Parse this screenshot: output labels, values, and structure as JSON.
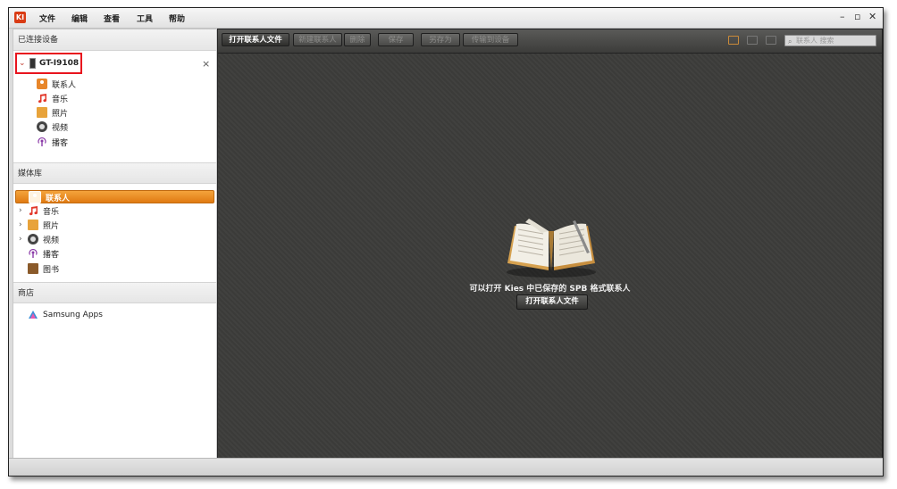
{
  "app": {
    "logo_text": "KI"
  },
  "menu": {
    "file": "文件",
    "edit": "编辑",
    "view": "查看",
    "tools": "工具",
    "help": "帮助"
  },
  "window_controls": {
    "minimize": "–",
    "restore": "▫",
    "close": "✕"
  },
  "sidebar": {
    "connected_header": "已连接设备",
    "device": {
      "name": "GT-I9108",
      "close": "×"
    },
    "device_items": [
      {
        "label": "联系人",
        "icon": "contacts-icon"
      },
      {
        "label": "音乐",
        "icon": "music-icon"
      },
      {
        "label": "照片",
        "icon": "photo-icon"
      },
      {
        "label": "视频",
        "icon": "video-icon"
      },
      {
        "label": "播客",
        "icon": "podcast-icon"
      }
    ],
    "library_header": "媒体库",
    "library_items": [
      {
        "label": "联系人",
        "icon": "contacts-icon",
        "selected": true
      },
      {
        "label": "音乐",
        "icon": "music-icon"
      },
      {
        "label": "照片",
        "icon": "photo-icon"
      },
      {
        "label": "视频",
        "icon": "video-icon"
      },
      {
        "label": "播客",
        "icon": "podcast-icon"
      },
      {
        "label": "图书",
        "icon": "book-icon"
      }
    ],
    "store_header": "商店",
    "store_items": [
      {
        "label": "Samsung Apps",
        "icon": "samsung-apps-icon"
      }
    ]
  },
  "toolbar": {
    "open_contacts_file": "打开联系人文件",
    "new_contact": "新建联系人",
    "delete": "删除",
    "save": "保存",
    "save_as": "另存为",
    "transfer_to_device": "传输到设备",
    "search_placeholder": "联系人 搜索"
  },
  "main": {
    "empty_message": "可以打开 Kies 中已保存的 SPB 格式联系人",
    "open_button": "打开联系人文件"
  },
  "colors": {
    "accent": "#e8862a",
    "highlight_border": "#e8141e",
    "main_bg": "#3d3d3b"
  }
}
